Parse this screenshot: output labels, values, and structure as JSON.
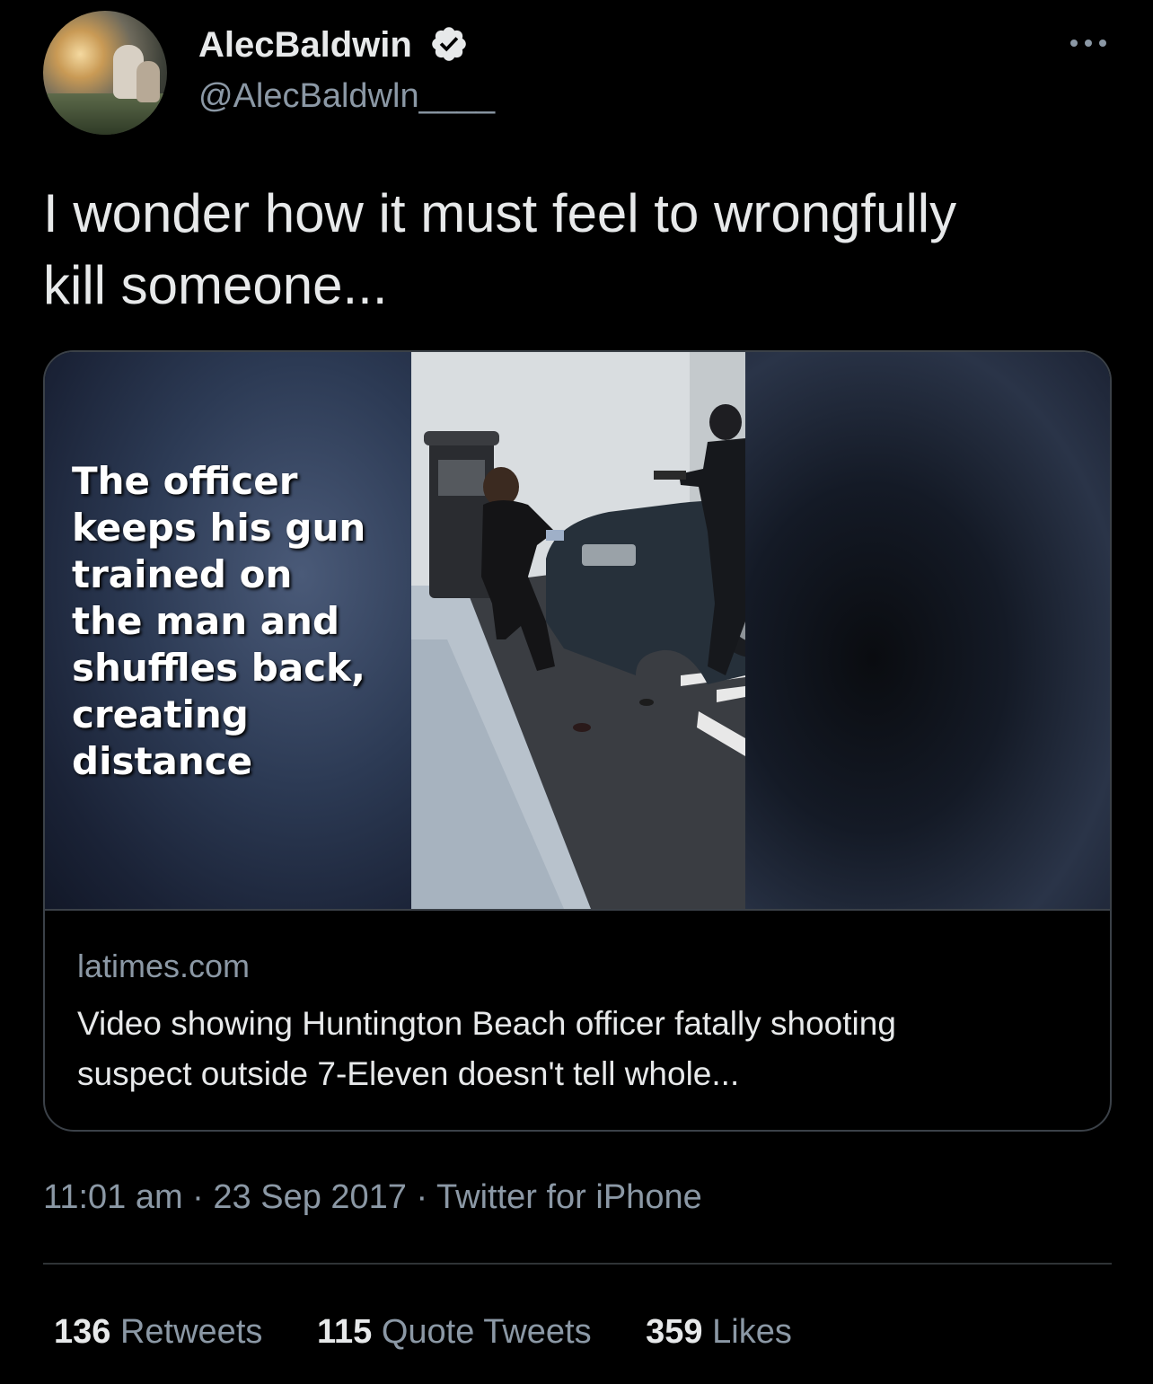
{
  "author": {
    "display_name": "AlecBaldwin",
    "handle": "@AlecBaldwln____",
    "verified_icon": "verified-badge-icon",
    "avatar": "profile-photo"
  },
  "more_icon": "more-options-icon",
  "tweet": {
    "text": "I wonder how it must feel to wrongfully\nkill someone..."
  },
  "card": {
    "caption": "The officer\nkeeps his gun\ntrained on\nthe man and\nshuffles back,\ncreating\ndistance",
    "domain": "latimes.com",
    "title": "Video showing Huntington Beach officer fatally shooting\nsuspect outside 7-Eleven doesn't tell whole..."
  },
  "meta": {
    "time": "11:01 am",
    "separator": " · ",
    "date": "23 Sep 2017",
    "source": "Twitter for iPhone"
  },
  "stats": {
    "retweets_count": "136",
    "retweets_label": "Retweets",
    "quotes_count": "115",
    "quotes_label": "Quote Tweets",
    "likes_count": "359",
    "likes_label": "Likes"
  },
  "colors": {
    "background": "#000000",
    "text_primary": "#e7e9ea",
    "text_secondary": "#8b98a5",
    "verified": "#e7e9ea",
    "border": "#3b4148"
  }
}
